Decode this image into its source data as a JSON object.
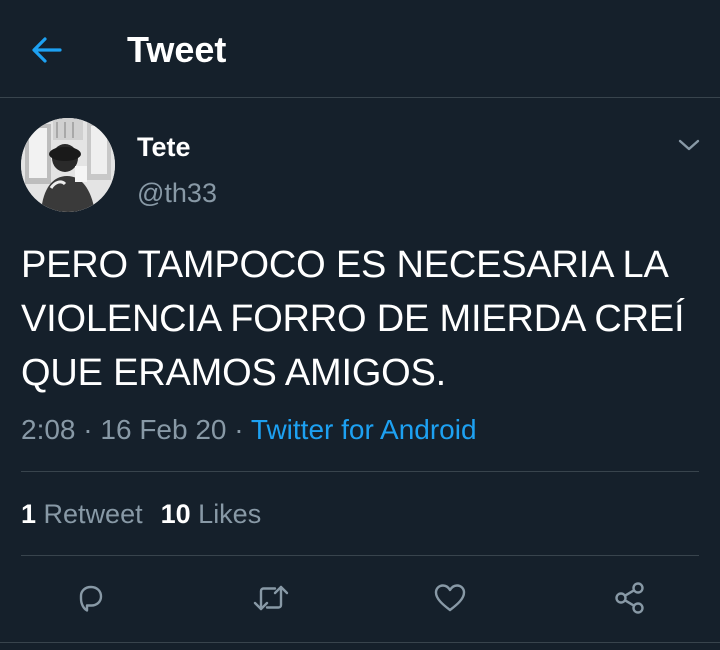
{
  "header": {
    "title": "Tweet",
    "back_icon": "arrow-left-icon"
  },
  "author": {
    "name": "Tete",
    "handle": "@th33"
  },
  "tweet": {
    "text_lines": [
      "PERO TAMPOCO ES NECESARIA LA",
      "VIOLENCIA FORRO DE MIERDA CREÍ",
      "QUE ERAMOS AMIGOS."
    ],
    "time": "2:08",
    "date": "16 Feb 20",
    "separator": "·",
    "source": "Twitter for Android"
  },
  "stats": {
    "retweets_count": "1",
    "retweets_label": "Retweet",
    "likes_count": "10",
    "likes_label": "Likes"
  },
  "actions": {
    "reply_icon": "reply-icon",
    "retweet_icon": "retweet-icon",
    "like_icon": "heart-icon",
    "share_icon": "share-icon"
  },
  "colors": {
    "background": "#15202b",
    "accent": "#1da1f2",
    "secondary_text": "#8899a6",
    "divider": "#38444d"
  }
}
